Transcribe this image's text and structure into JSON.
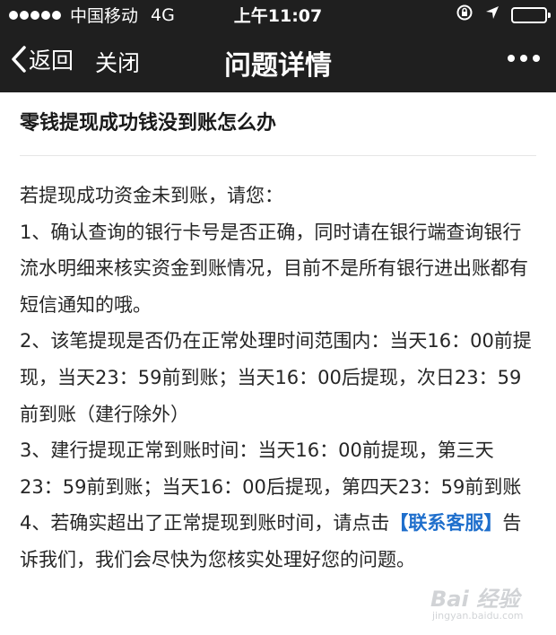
{
  "status_bar": {
    "carrier": "中国移动",
    "network": "4G",
    "time": "上午11:07"
  },
  "nav": {
    "back_label": "返回",
    "close_label": "关闭",
    "title": "问题详情"
  },
  "article": {
    "title": "零钱提现成功钱没到账怎么办",
    "intro": "若提现成功资金未到账，请您：",
    "item1": "1、确认查询的银行卡号是否正确，同时请在银行端查询银行流水明细来核实资金到账情况，目前不是所有银行进出账都有短信通知的哦。",
    "item2": "2、该笔提现是否仍在正常处理时间范围内：当天16：00前提现，当天23：59前到账；当天16：00后提现，次日23：59前到账（建行除外）",
    "item3": "3、建行提现正常到账时间：当天16：00前提现，第三天23：59前到账；当天16：00后提现，第四天23：59前到账",
    "item4_prefix": "4、若确实超出了正常提现到账时间，请点击",
    "item4_link": "【联系客服】",
    "item4_suffix": "告诉我们，我们会尽快为您核实处理好您的问题。"
  },
  "watermark": {
    "text": "Bai 经验",
    "url": "jingyan.baidu.com"
  },
  "colors": {
    "nav_bg": "#1f1f1f",
    "link": "#1f6fcc"
  }
}
